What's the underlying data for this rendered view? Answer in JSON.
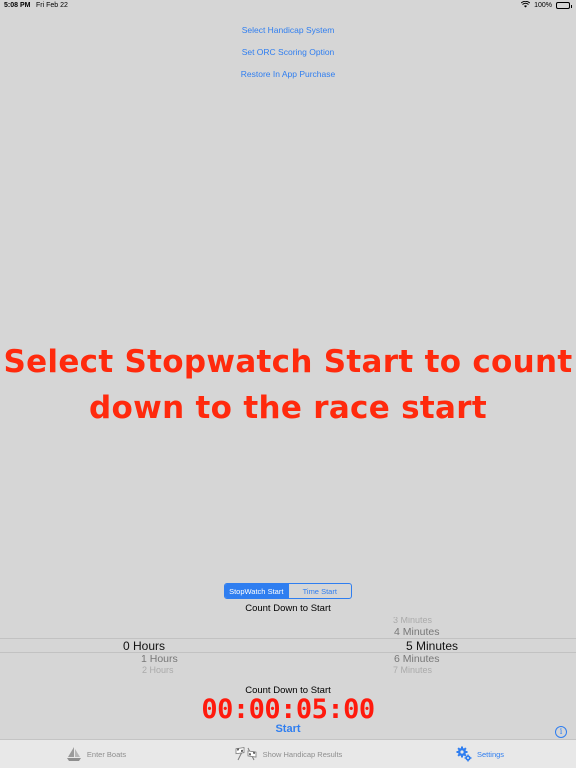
{
  "status_bar": {
    "time": "5:08 PM",
    "date": "Fri Feb 22",
    "battery": "100%"
  },
  "menu": {
    "select_handicap": "Select Handicap System",
    "set_orc": "Set ORC Scoring Option",
    "restore_purchase": "Restore In App Purchase"
  },
  "headline": {
    "line1": "Select Stopwatch Start to count",
    "line2": "down to the race start"
  },
  "start_mode": {
    "stopwatch": "StopWatch Start",
    "time": "Time Start",
    "selected": "StopWatch Start"
  },
  "count_down_label": "Count Down to Start",
  "picker": {
    "hours": {
      "selected": "0 Hours",
      "below_1": "1 Hours",
      "below_2": "2 Hours"
    },
    "minutes": {
      "above_2": "3 Minutes",
      "above_1": "4 Minutes",
      "selected": "5 Minutes",
      "below_1": "6 Minutes",
      "below_2": "7 Minutes"
    }
  },
  "countdown_label_2": "Count Down to Start",
  "timer": "00:00:05:00",
  "start_button": "Start",
  "tabs": [
    {
      "label": "Enter Boats",
      "icon": "sailboat-icon"
    },
    {
      "label": "Show Handicap Results",
      "icon": "checkered-flags-icon"
    },
    {
      "label": "Settings",
      "icon": "gears-icon"
    }
  ],
  "colors": {
    "accent": "#2f7ef0",
    "headline": "#ff2a0d",
    "timer": "#ff1a0d",
    "background": "#d6d6d6"
  }
}
